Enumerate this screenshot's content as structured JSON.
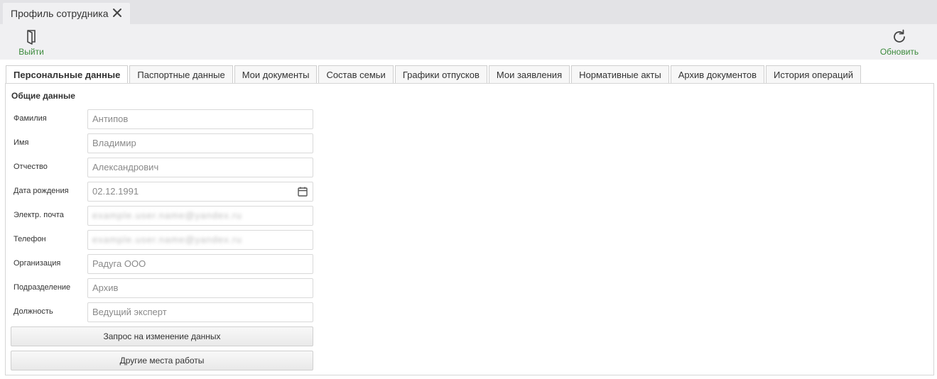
{
  "window_tab": {
    "title": "Профиль сотрудника",
    "close_icon": "close-icon"
  },
  "toolbar": {
    "exit_label": "Выйти",
    "refresh_label": "Обновить",
    "accent_color": "#3c8a3c"
  },
  "tabs": [
    {
      "label": "Персональные данные",
      "active": true
    },
    {
      "label": "Паспортные данные"
    },
    {
      "label": "Мои документы"
    },
    {
      "label": "Состав семьи"
    },
    {
      "label": "Графики отпусков"
    },
    {
      "label": "Мои заявления"
    },
    {
      "label": "Нормативные акты"
    },
    {
      "label": "Архив документов"
    },
    {
      "label": "История операций"
    }
  ],
  "section": {
    "title": "Общие данные"
  },
  "fields": [
    {
      "label": "Фамилия",
      "value": "Антипов"
    },
    {
      "label": "Имя",
      "value": "Владимир"
    },
    {
      "label": "Отчество",
      "value": "Александрович"
    },
    {
      "label": "Дата рождения",
      "value": "02.12.1991"
    },
    {
      "label": "Электр. почта",
      "value": "example.user.name@yandex.ru"
    },
    {
      "label": "Телефон",
      "value": "example.user.name@yandex.ru"
    },
    {
      "label": "Организация",
      "value": "Радуга ООО"
    },
    {
      "label": "Подразделение",
      "value": "Архив"
    },
    {
      "label": "Должность",
      "value": "Ведущий эксперт"
    }
  ],
  "buttons": {
    "request_change": "Запрос на изменение данных",
    "other_jobs": "Другие места работы"
  }
}
